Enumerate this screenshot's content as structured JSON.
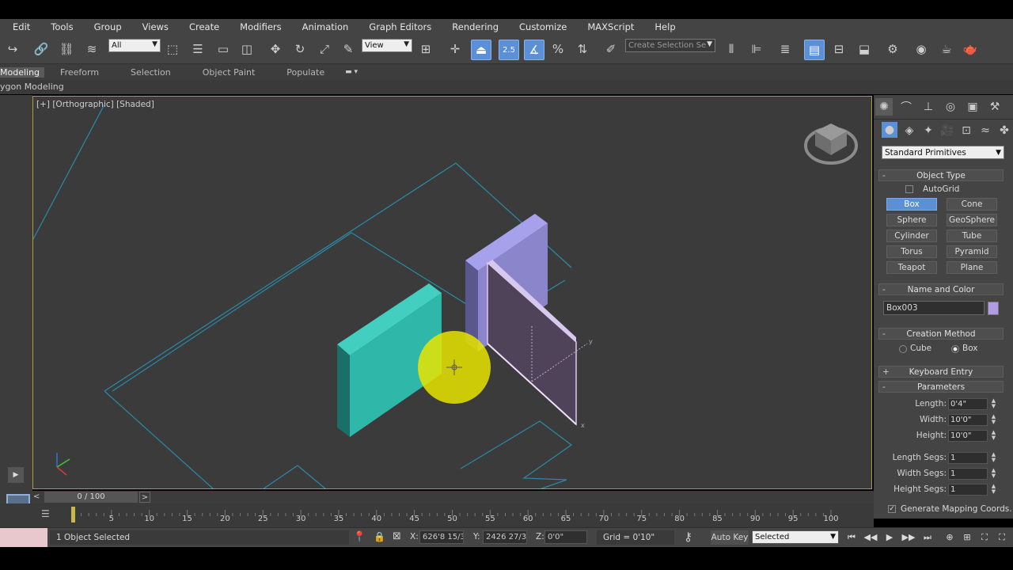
{
  "menu": [
    "Edit",
    "Tools",
    "Group",
    "Views",
    "Create",
    "Modifiers",
    "Animation",
    "Graph Editors",
    "Rendering",
    "Customize",
    "MAXScript",
    "Help"
  ],
  "toolbar": {
    "selection_filter": "All",
    "ref_coord": "View",
    "snap_label": "2.5",
    "named_selection_placeholder": "Create Selection Se"
  },
  "ribbon": {
    "tabs": [
      "Modeling",
      "Freeform",
      "Selection",
      "Object Paint",
      "Populate"
    ],
    "sub_label": "ygon Modeling"
  },
  "viewport": {
    "label": "[+] [Orthographic] [Shaded]"
  },
  "command_panel": {
    "category": "Standard Primitives",
    "object_type": {
      "title": "Object Type",
      "autogrid_label": "AutoGrid",
      "buttons": [
        "Box",
        "Cone",
        "Sphere",
        "GeoSphere",
        "Cylinder",
        "Tube",
        "Torus",
        "Pyramid",
        "Teapot",
        "Plane"
      ],
      "active": "Box"
    },
    "name_and_color": {
      "title": "Name and Color",
      "name": "Box003",
      "color": "#b49ae6"
    },
    "creation_method": {
      "title": "Creation Method",
      "options": [
        "Cube",
        "Box"
      ],
      "selected": "Box"
    },
    "keyboard_entry": "Keyboard Entry",
    "parameters": {
      "title": "Parameters",
      "fields": [
        {
          "label": "Length:",
          "value": "0'4\""
        },
        {
          "label": "Width:",
          "value": "10'0\""
        },
        {
          "label": "Height:",
          "value": "10'0\""
        },
        {
          "label": "Length Segs:",
          "value": "1"
        },
        {
          "label": "Width Segs:",
          "value": "1"
        },
        {
          "label": "Height Segs:",
          "value": "1"
        }
      ],
      "mapping_label": "Generate Mapping Coords."
    }
  },
  "timeline": {
    "frame_label": "0 / 100",
    "ticks": [
      "5",
      "10",
      "15",
      "20",
      "25",
      "30",
      "35",
      "40",
      "45",
      "50",
      "55",
      "60",
      "65",
      "70",
      "75",
      "80",
      "85",
      "90",
      "95",
      "100"
    ]
  },
  "status": {
    "selection_text": "1 Object Selected",
    "x_label": "X:",
    "x_value": "626'8 15/3",
    "y_label": "Y:",
    "y_value": "2426 27/3",
    "z_label": "Z:",
    "z_value": "0'0\"",
    "grid_text": "Grid = 0'10\"",
    "autokey_label": "Auto Key",
    "keymode_value": "Selected"
  },
  "colors": {
    "teal_box": "#2fb8aa",
    "lavender_box": "#9d97e0",
    "accent_blue": "#5b8fd6",
    "grid_line": "#2a8aa8",
    "cursor_highlight": "#e8e400"
  }
}
